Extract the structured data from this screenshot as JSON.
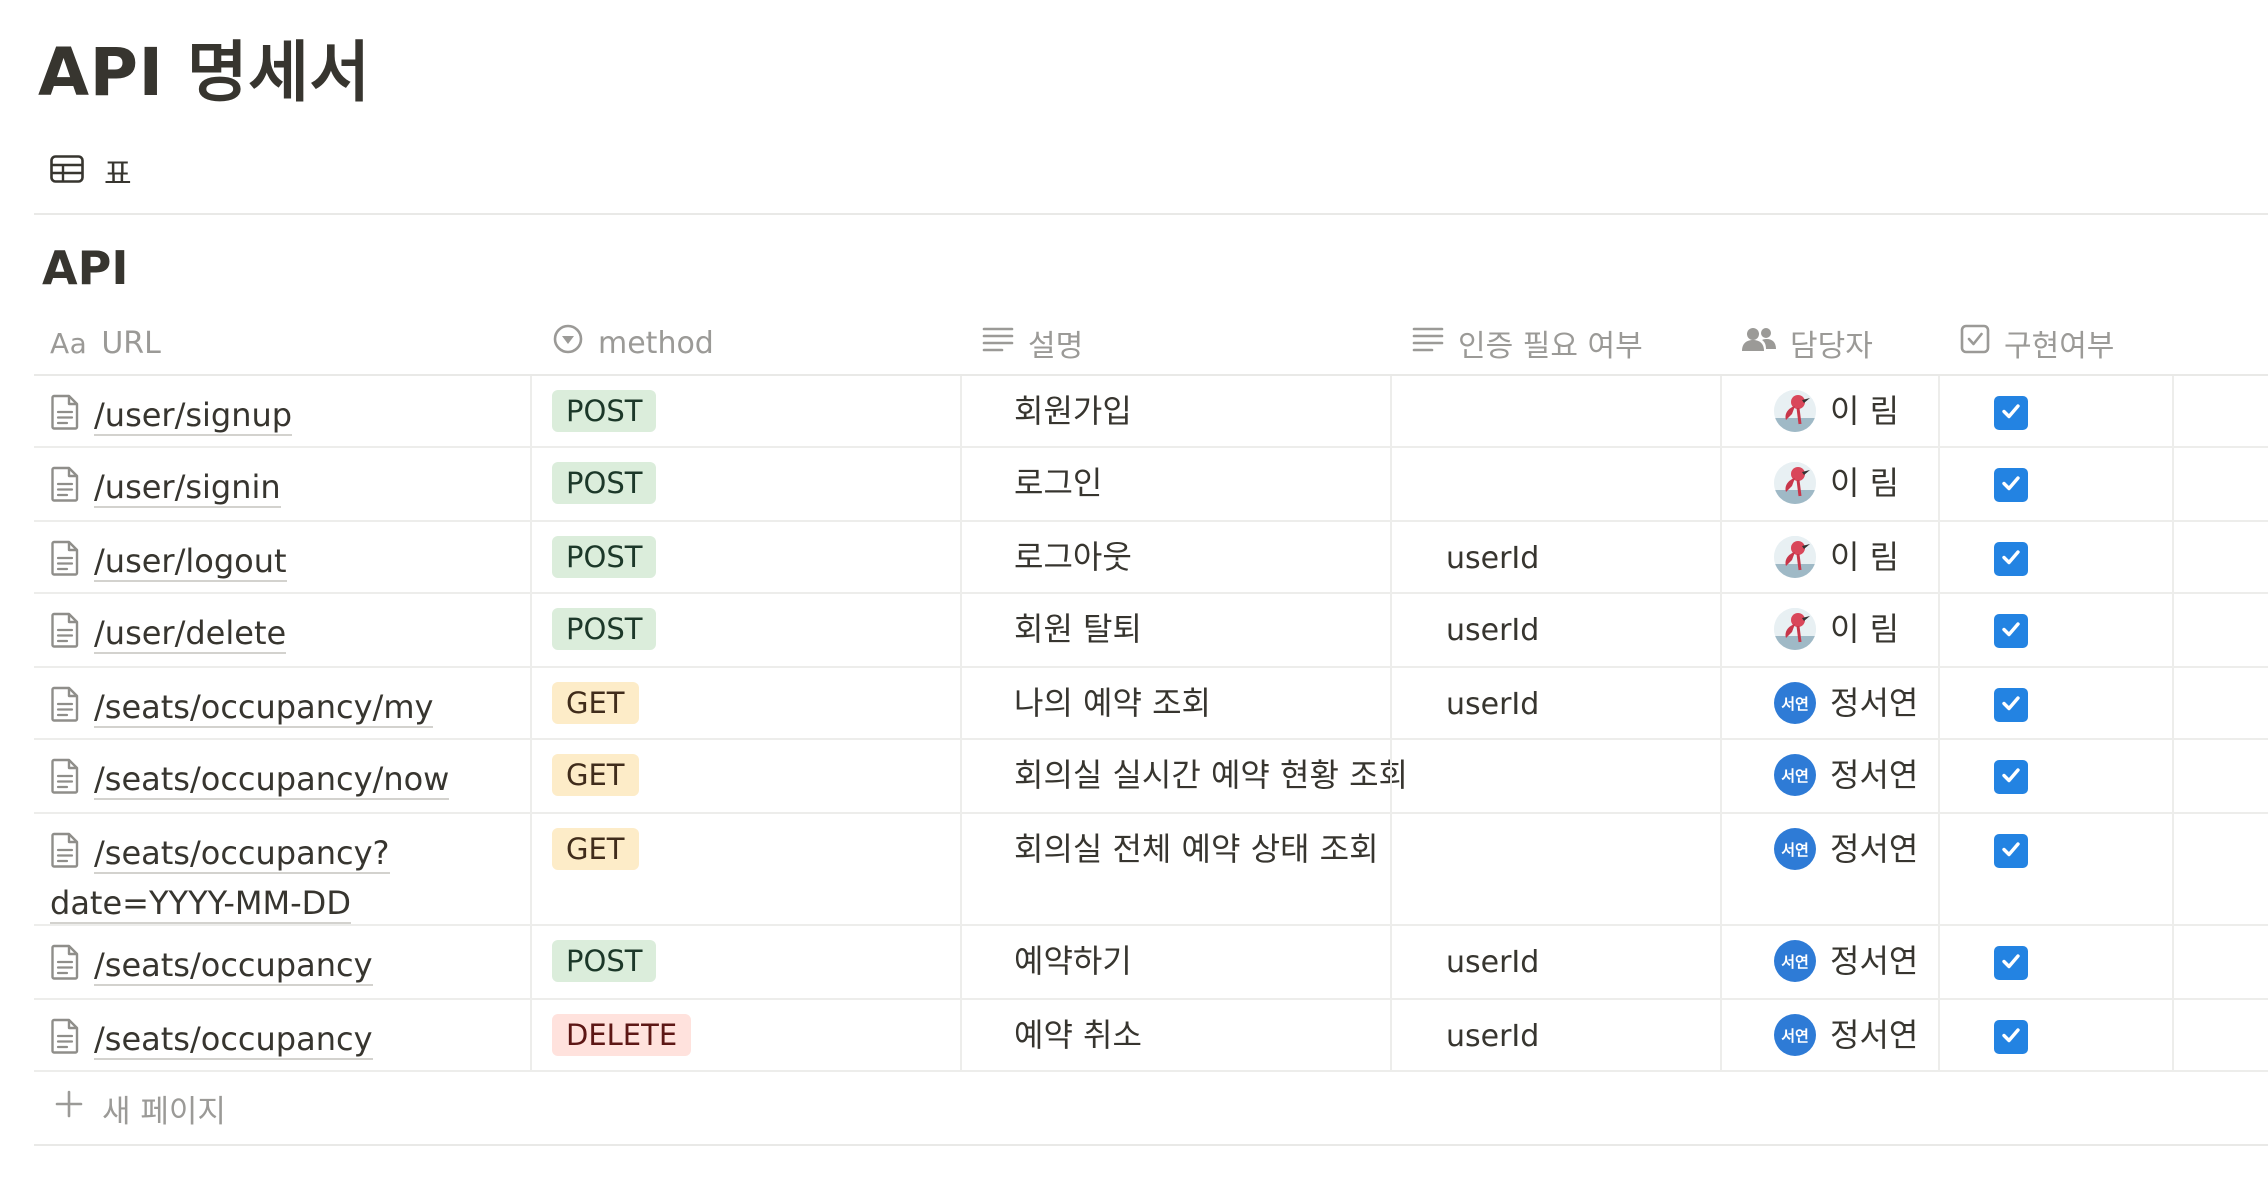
{
  "page": {
    "title": "API 명세서"
  },
  "view": {
    "icon": "table-icon",
    "label": "표"
  },
  "database": {
    "title": "API"
  },
  "columns": {
    "url": {
      "type_label": "Aa",
      "label": "URL"
    },
    "method": {
      "icon": "select-icon",
      "label": "method"
    },
    "description": {
      "icon": "text-icon",
      "label": "설명"
    },
    "auth": {
      "icon": "text-icon",
      "label": "인증 필요 여부"
    },
    "owner": {
      "icon": "people-icon",
      "label": "담당자"
    },
    "implemented": {
      "icon": "checkbox-icon",
      "label": "구현여부"
    }
  },
  "rows": [
    {
      "url": "/user/signup",
      "method": "POST",
      "description": "회원가입",
      "auth": "",
      "owner": "이 림",
      "owner_avatar": "photo",
      "implemented": true
    },
    {
      "url": "/user/signin",
      "method": "POST",
      "description": "로그인",
      "auth": "",
      "owner": "이 림",
      "owner_avatar": "photo",
      "implemented": true
    },
    {
      "url": "/user/logout",
      "method": "POST",
      "description": "로그아웃",
      "auth": "userId",
      "owner": "이 림",
      "owner_avatar": "photo",
      "implemented": true
    },
    {
      "url": "/user/delete",
      "method": "POST",
      "description": "회원 탈퇴",
      "auth": "userId",
      "owner": "이 림",
      "owner_avatar": "photo",
      "implemented": true
    },
    {
      "url": "/seats/occupancy/my",
      "method": "GET",
      "description": "나의 예약 조회",
      "auth": "userId",
      "owner": "정서연",
      "owner_avatar_text": "서연",
      "implemented": true
    },
    {
      "url": "/seats/occupancy/now",
      "method": "GET",
      "description": "회의실 실시간 예약 현황 조회",
      "auth": "",
      "owner": "정서연",
      "owner_avatar_text": "서연",
      "implemented": true
    },
    {
      "url_line1": "/seats/occupancy?",
      "url_line2": "date=YYYY-MM-DD",
      "method": "GET",
      "description": "회의실 전체 예약 상태 조회",
      "auth": "",
      "owner": "정서연",
      "owner_avatar_text": "서연",
      "implemented": true
    },
    {
      "url": "/seats/occupancy",
      "method": "POST",
      "description": "예약하기",
      "auth": "userId",
      "owner": "정서연",
      "owner_avatar_text": "서연",
      "implemented": true
    },
    {
      "url": "/seats/occupancy",
      "method": "DELETE",
      "description": "예약 취소",
      "auth": "userId",
      "owner": "정서연",
      "owner_avatar_text": "서연",
      "implemented": true
    }
  ],
  "new_page": {
    "label": "새 페이지"
  },
  "colors": {
    "post_bg": "#dbeddb",
    "get_bg": "#fdecc8",
    "delete_bg": "#ffe2dd",
    "checkbox": "#2383e2"
  }
}
